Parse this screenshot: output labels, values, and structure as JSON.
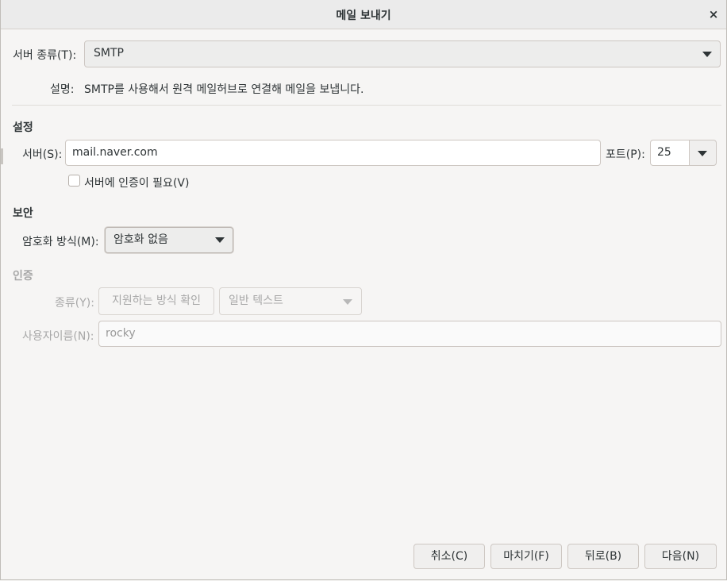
{
  "window": {
    "title": "메일 보내기",
    "close_glyph": "×"
  },
  "server_type": {
    "label": "서버 종류(T):",
    "value": "SMTP",
    "description_label": "설명:",
    "description": "SMTP를 사용해서 원격 메일허브로 연결해 메일을 보냅니다."
  },
  "settings": {
    "heading": "설정",
    "server_label": "서버(S):",
    "server_value": "mail.naver.com",
    "port_label": "포트(P):",
    "port_value": "25",
    "auth_required_label": "서버에 인증이 필요(V)"
  },
  "security": {
    "heading": "보안",
    "encryption_label": "암호화 방식(M):",
    "encryption_value": "암호화 없음"
  },
  "authentication": {
    "heading": "인증",
    "type_label": "종류(Y):",
    "check_methods_button": "지원하는 방식 확인",
    "type_value": "일반 텍스트",
    "username_label": "사용자이름(N):",
    "username_value": "rocky"
  },
  "footer": {
    "cancel": "취소(C)",
    "finish": "마치기(F)",
    "back": "뒤로(B)",
    "next": "다음(N)"
  }
}
